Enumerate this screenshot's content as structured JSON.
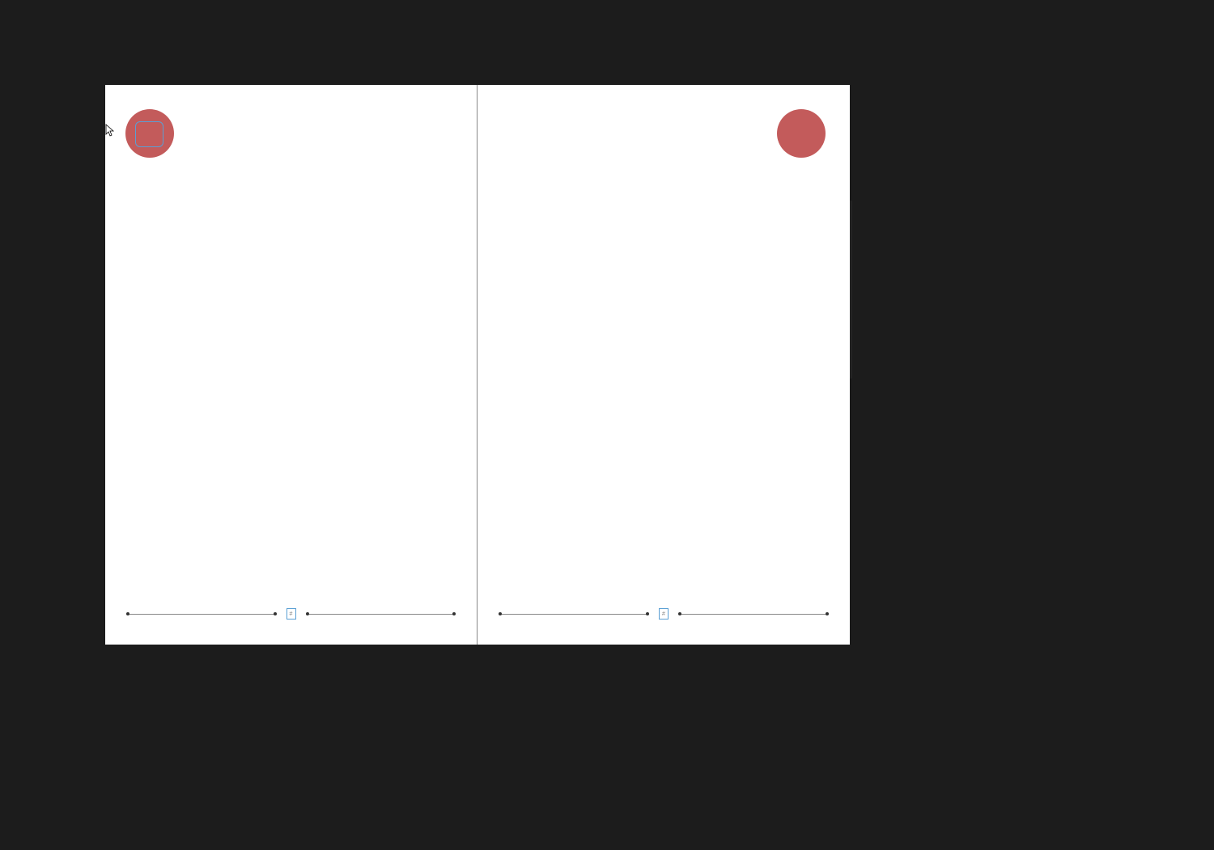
{
  "canvas": {
    "background_color": "#1c1c1c"
  },
  "spread": {
    "left_page": {
      "circle": {
        "color": "#c35b5b",
        "position": "top-left"
      },
      "selected_object": {
        "type": "rounded-rectangle-frame",
        "selection_color": "#5a9fd4"
      },
      "footer": {
        "page_number_marker": "#"
      }
    },
    "right_page": {
      "circle": {
        "color": "#c35b5b",
        "position": "top-right"
      },
      "footer": {
        "page_number_marker": "#"
      }
    }
  },
  "cursor": {
    "type": "selection-arrow"
  }
}
